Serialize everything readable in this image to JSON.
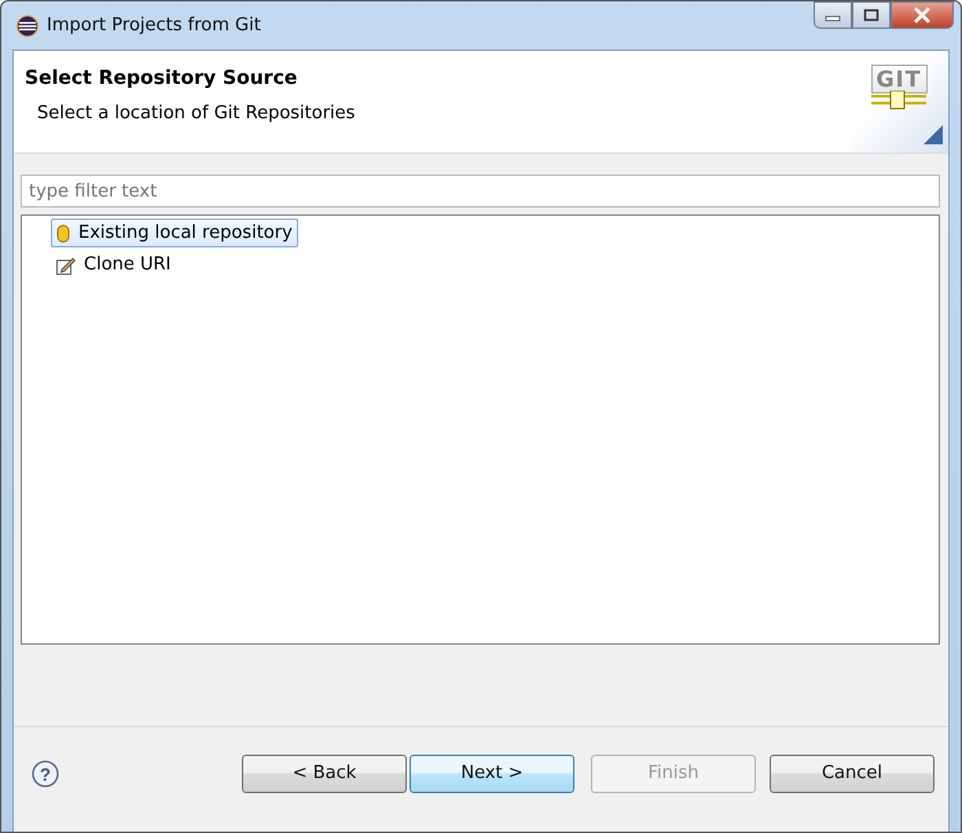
{
  "window": {
    "title": "Import Projects from Git"
  },
  "header": {
    "title": "Select Repository Source",
    "subtitle": "Select a location of Git Repositories",
    "logo": "GIT"
  },
  "filter": {
    "placeholder": "type filter text"
  },
  "tree": {
    "items": [
      {
        "label": "Existing local repository",
        "kind": "repository",
        "selected": true
      },
      {
        "label": "Clone URI",
        "kind": "clone",
        "selected": false
      }
    ]
  },
  "help": {
    "label": "?"
  },
  "buttons": [
    {
      "label": "< Back",
      "default": false,
      "disabled": false
    },
    {
      "label": "Next >",
      "default": true,
      "disabled": false
    },
    {
      "label": "Finish",
      "default": false,
      "disabled": true
    },
    {
      "label": "Cancel",
      "default": false,
      "disabled": false
    }
  ]
}
